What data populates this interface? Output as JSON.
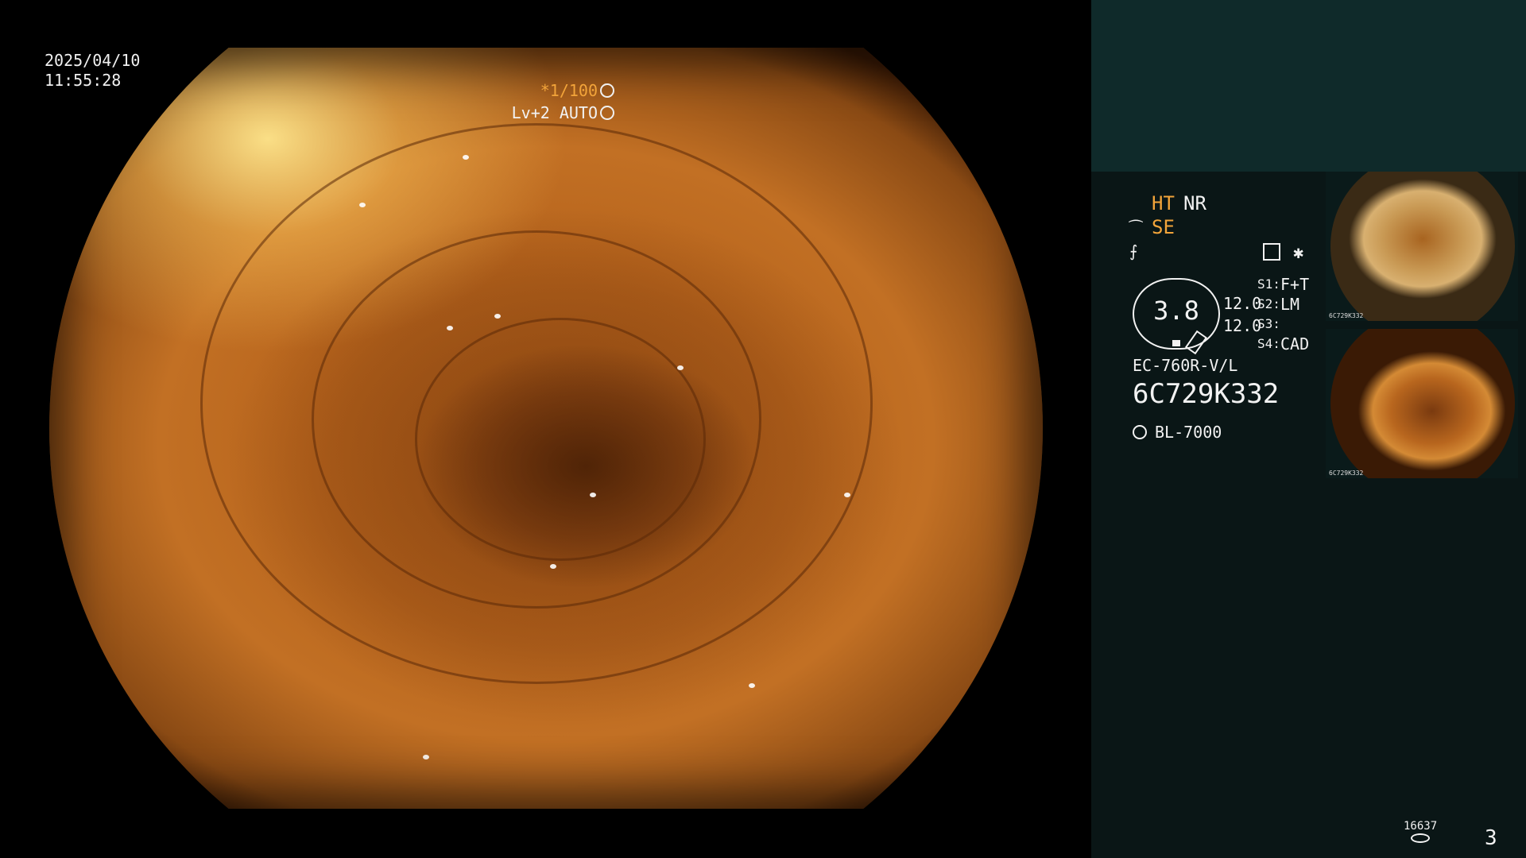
{
  "timestamp": {
    "date": "2025/04/10",
    "time": "11:55:28"
  },
  "overlay": {
    "shutter": "*1/100",
    "level": "Lv+2 AUTO"
  },
  "panel": {
    "ht": "HT",
    "nr": "NR",
    "se": "SE",
    "gauge_value": "3.8",
    "gauge_nums": [
      "12.0",
      "12.0"
    ],
    "switches": [
      {
        "label": "S1:",
        "value": "F+T"
      },
      {
        "label": "S2:",
        "value": "LM"
      },
      {
        "label": "S3:",
        "value": ""
      },
      {
        "label": "S4:",
        "value": "CAD"
      }
    ],
    "model": "EC-760R-V/L",
    "serial": "6C729K332",
    "light_source": "BL-7000"
  },
  "thumbnails": [
    {
      "caption": "6C729K332"
    },
    {
      "caption": "6C729K332"
    }
  ],
  "footer": {
    "image_count": "16637",
    "page": "3"
  },
  "colors": {
    "accent": "#f2a43a",
    "panel_bg": "#0a1616",
    "panel_top": "#0f2a2a"
  }
}
